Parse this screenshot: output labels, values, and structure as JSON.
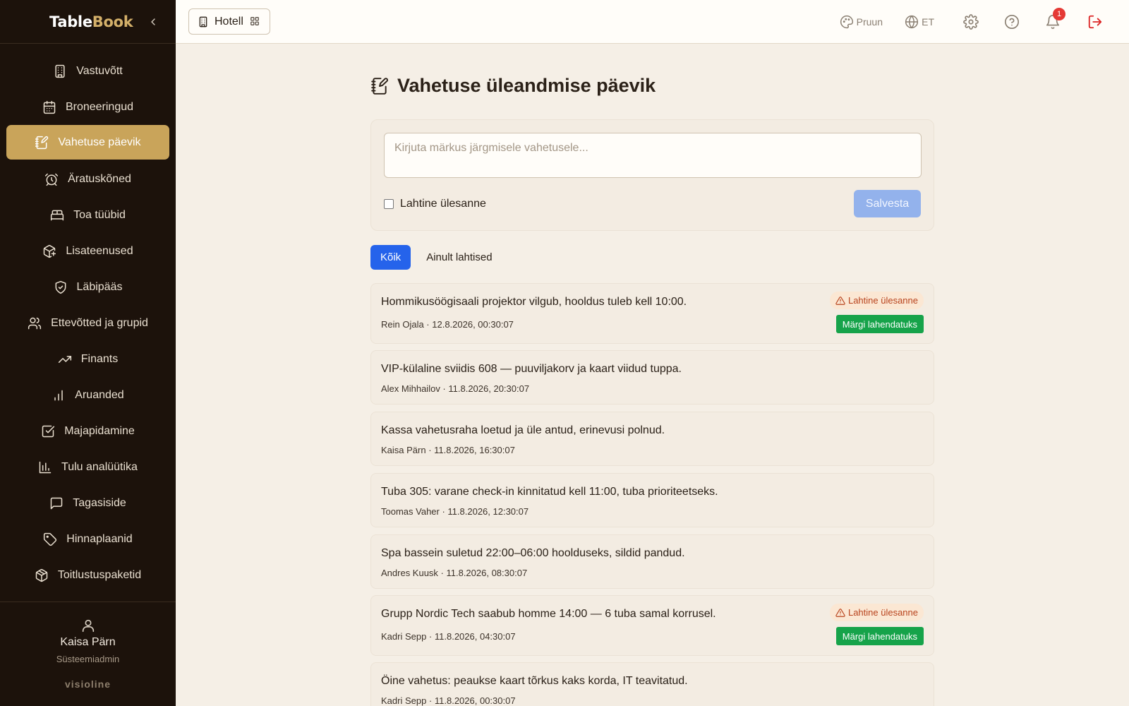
{
  "brand": {
    "part1": "Table",
    "part2": "Book"
  },
  "sidebar": {
    "items": [
      {
        "label": "Vastuvõtt",
        "icon": "building-icon"
      },
      {
        "label": "Broneeringud",
        "icon": "calendar-icon"
      },
      {
        "label": "Vahetuse päevik",
        "icon": "notebook-pen-icon",
        "active": true
      },
      {
        "label": "Äratuskõned",
        "icon": "alarm-clock-icon"
      },
      {
        "label": "Toa tüübid",
        "icon": "bed-icon"
      },
      {
        "label": "Lisateenused",
        "icon": "package-plus-icon"
      },
      {
        "label": "Läbipääs",
        "icon": "shield-check-icon"
      },
      {
        "label": "Ettevõtted ja grupid",
        "icon": "users-icon"
      },
      {
        "label": "Finants",
        "icon": "trending-up-icon"
      },
      {
        "label": "Aruanded",
        "icon": "bar-chart-icon"
      },
      {
        "label": "Majapidamine",
        "icon": "check-square-icon"
      },
      {
        "label": "Tulu analüütika",
        "icon": "chart-columns-icon"
      },
      {
        "label": "Tagasiside",
        "icon": "message-square-icon"
      },
      {
        "label": "Hinnaplaanid",
        "icon": "tag-icon"
      },
      {
        "label": "Toitlustuspaketid",
        "icon": "box-icon"
      }
    ]
  },
  "user": {
    "name": "Kaisa Pärn",
    "role": "Süsteemiadmin"
  },
  "vendor": "visioline",
  "topbar": {
    "hotel_label": "Hotell",
    "theme_label": "Pruun",
    "lang_label": "ET",
    "notifications_count": "1"
  },
  "page": {
    "title": "Vahetuse üleandmise päevik",
    "note_placeholder": "Kirjuta märkus järgmisele vahetusele...",
    "open_task_label": "Lahtine ülesanne",
    "save_label": "Salvesta",
    "filters": {
      "all": "Kõik",
      "open_only": "Ainult lahtised"
    }
  },
  "entries": [
    {
      "text": "Hommikusöögisaali projektor vilgub, hooldus tuleb kell 10:00.",
      "meta": "Rein Ojala · 12.8.2026, 00:30:07",
      "open": true,
      "tag": "Lahtine ülesanne",
      "action": "Märgi lahendatuks"
    },
    {
      "text": "VIP-külaline sviidis 608 — puuviljakorv ja kaart viidud tuppa.",
      "meta": "Alex Mihhailov · 11.8.2026, 20:30:07",
      "open": false
    },
    {
      "text": "Kassa vahetusraha loetud ja üle antud, erinevusi polnud.",
      "meta": "Kaisa Pärn · 11.8.2026, 16:30:07",
      "open": false
    },
    {
      "text": "Tuba 305: varane check-in kinnitatud kell 11:00, tuba prioriteetseks.",
      "meta": "Toomas Vaher · 11.8.2026, 12:30:07",
      "open": false
    },
    {
      "text": "Spa bassein suletud 22:00–06:00 hoolduseks, sildid pandud.",
      "meta": "Andres Kuusk · 11.8.2026, 08:30:07",
      "open": false
    },
    {
      "text": "Grupp Nordic Tech saabub homme 14:00 — 6 tuba samal korrusel.",
      "meta": "Kadri Sepp · 11.8.2026, 04:30:07",
      "open": true,
      "tag": "Lahtine ülesanne",
      "action": "Märgi lahendatuks"
    },
    {
      "text": "Öine vahetus: peaukse kaart tõrkus kaks korda, IT teavitatud.",
      "meta": "Kadri Sepp · 11.8.2026, 00:30:07",
      "open": false
    }
  ]
}
